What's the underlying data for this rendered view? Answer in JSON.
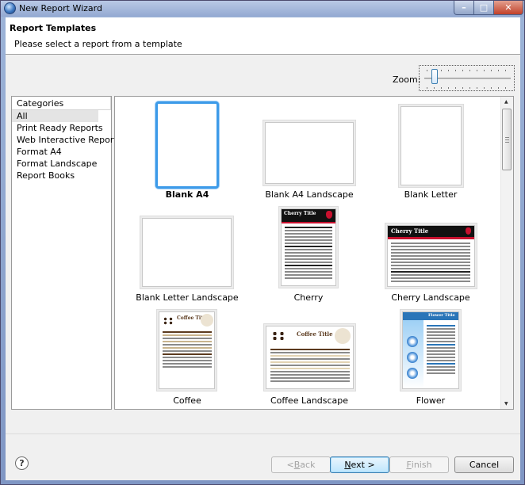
{
  "window": {
    "title": "New Report Wizard",
    "minimize_glyph": "–",
    "maximize_glyph": "□",
    "close_glyph": "✕"
  },
  "header": {
    "title": "Report Templates",
    "subtitle": "Please select a report from a template"
  },
  "zoom": {
    "label": "Zoom:",
    "level": 0.08
  },
  "categories": {
    "header": "Categories",
    "items": [
      "All",
      "Print Ready Reports",
      "Web Interactive Reports",
      "Format A4",
      "Format Landscape",
      "Report Books"
    ],
    "selected": "All"
  },
  "templates": [
    {
      "label": "Blank A4",
      "selected": true
    },
    {
      "label": "Blank A4 Landscape",
      "selected": false
    },
    {
      "label": "Blank Letter",
      "selected": false
    },
    {
      "label": "Blank Letter Landscape",
      "selected": false
    },
    {
      "label": "Cherry",
      "selected": false,
      "preview_title": "Cherry Title"
    },
    {
      "label": "Cherry Landscape",
      "selected": false,
      "preview_title": "Cherry Title"
    },
    {
      "label": "Coffee",
      "selected": false,
      "preview_title": "Coffee Title"
    },
    {
      "label": "Coffee Landscape",
      "selected": false,
      "preview_title": "Coffee Title"
    },
    {
      "label": "Flower",
      "selected": false,
      "preview_title": "Flower Title"
    }
  ],
  "buttons": {
    "help": "?",
    "back": "< Back",
    "back_mnemonic": "B",
    "next": "Next >",
    "next_mnemonic": "N",
    "finish": "Finish",
    "finish_mnemonic": "F",
    "cancel": "Cancel"
  },
  "colors": {
    "selection": "#3d9be9",
    "cherry_red": "#c8102e",
    "coffee_brown": "#5b3a1e",
    "flower_blue": "#2a75b8"
  }
}
